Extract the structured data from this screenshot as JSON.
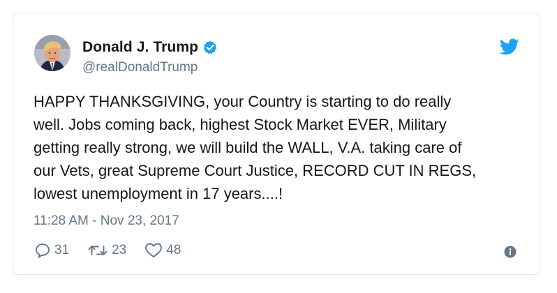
{
  "tweet": {
    "display_name": "Donald J. Trump",
    "handle": "@realDonaldTrump",
    "text": "HAPPY THANKSGIVING, your Country is starting to do really\nwell. Jobs coming back, highest Stock Market EVER, Military\ngetting really strong, we will build the WALL, V.A. taking care of\nour Vets, great Supreme Court Justice, RECORD CUT IN REGS,\nlowest unemployment in 17 years....!",
    "timestamp": "11:28 AM - Nov 23, 2017",
    "replies": "31",
    "retweets": "23",
    "likes": "48",
    "verified": true
  },
  "icons": {
    "avatar": "profile-photo",
    "verified": "verified-badge-icon",
    "brand": "twitter-bird-icon",
    "reply": "reply-icon",
    "retweet": "retweet-icon",
    "like": "heart-icon",
    "info": "info-icon"
  },
  "colors": {
    "brand": "#1da1f2",
    "text": "#14171a",
    "secondary": "#657786",
    "border": "#e1e8ed"
  }
}
